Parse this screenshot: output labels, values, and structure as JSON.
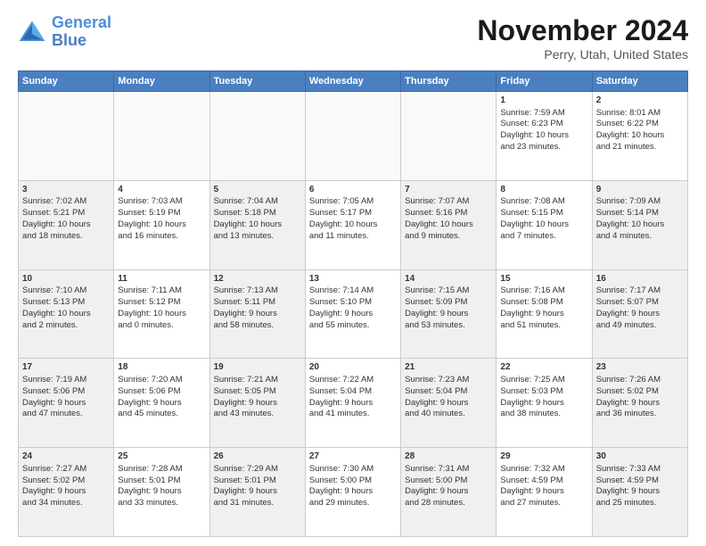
{
  "header": {
    "logo_line1": "General",
    "logo_line2": "Blue",
    "title": "November 2024",
    "location": "Perry, Utah, United States"
  },
  "weekdays": [
    "Sunday",
    "Monday",
    "Tuesday",
    "Wednesday",
    "Thursday",
    "Friday",
    "Saturday"
  ],
  "weeks": [
    [
      {
        "day": "",
        "content": "",
        "empty": true
      },
      {
        "day": "",
        "content": "",
        "empty": true
      },
      {
        "day": "",
        "content": "",
        "empty": true
      },
      {
        "day": "",
        "content": "",
        "empty": true
      },
      {
        "day": "",
        "content": "",
        "empty": true
      },
      {
        "day": "1",
        "content": "Sunrise: 7:59 AM\nSunset: 6:23 PM\nDaylight: 10 hours\nand 23 minutes."
      },
      {
        "day": "2",
        "content": "Sunrise: 8:01 AM\nSunset: 6:22 PM\nDaylight: 10 hours\nand 21 minutes."
      }
    ],
    [
      {
        "day": "3",
        "content": "Sunrise: 7:02 AM\nSunset: 5:21 PM\nDaylight: 10 hours\nand 18 minutes.",
        "shaded": true
      },
      {
        "day": "4",
        "content": "Sunrise: 7:03 AM\nSunset: 5:19 PM\nDaylight: 10 hours\nand 16 minutes."
      },
      {
        "day": "5",
        "content": "Sunrise: 7:04 AM\nSunset: 5:18 PM\nDaylight: 10 hours\nand 13 minutes.",
        "shaded": true
      },
      {
        "day": "6",
        "content": "Sunrise: 7:05 AM\nSunset: 5:17 PM\nDaylight: 10 hours\nand 11 minutes."
      },
      {
        "day": "7",
        "content": "Sunrise: 7:07 AM\nSunset: 5:16 PM\nDaylight: 10 hours\nand 9 minutes.",
        "shaded": true
      },
      {
        "day": "8",
        "content": "Sunrise: 7:08 AM\nSunset: 5:15 PM\nDaylight: 10 hours\nand 7 minutes."
      },
      {
        "day": "9",
        "content": "Sunrise: 7:09 AM\nSunset: 5:14 PM\nDaylight: 10 hours\nand 4 minutes.",
        "shaded": true
      }
    ],
    [
      {
        "day": "10",
        "content": "Sunrise: 7:10 AM\nSunset: 5:13 PM\nDaylight: 10 hours\nand 2 minutes.",
        "shaded": true
      },
      {
        "day": "11",
        "content": "Sunrise: 7:11 AM\nSunset: 5:12 PM\nDaylight: 10 hours\nand 0 minutes."
      },
      {
        "day": "12",
        "content": "Sunrise: 7:13 AM\nSunset: 5:11 PM\nDaylight: 9 hours\nand 58 minutes.",
        "shaded": true
      },
      {
        "day": "13",
        "content": "Sunrise: 7:14 AM\nSunset: 5:10 PM\nDaylight: 9 hours\nand 55 minutes."
      },
      {
        "day": "14",
        "content": "Sunrise: 7:15 AM\nSunset: 5:09 PM\nDaylight: 9 hours\nand 53 minutes.",
        "shaded": true
      },
      {
        "day": "15",
        "content": "Sunrise: 7:16 AM\nSunset: 5:08 PM\nDaylight: 9 hours\nand 51 minutes."
      },
      {
        "day": "16",
        "content": "Sunrise: 7:17 AM\nSunset: 5:07 PM\nDaylight: 9 hours\nand 49 minutes.",
        "shaded": true
      }
    ],
    [
      {
        "day": "17",
        "content": "Sunrise: 7:19 AM\nSunset: 5:06 PM\nDaylight: 9 hours\nand 47 minutes.",
        "shaded": true
      },
      {
        "day": "18",
        "content": "Sunrise: 7:20 AM\nSunset: 5:06 PM\nDaylight: 9 hours\nand 45 minutes."
      },
      {
        "day": "19",
        "content": "Sunrise: 7:21 AM\nSunset: 5:05 PM\nDaylight: 9 hours\nand 43 minutes.",
        "shaded": true
      },
      {
        "day": "20",
        "content": "Sunrise: 7:22 AM\nSunset: 5:04 PM\nDaylight: 9 hours\nand 41 minutes."
      },
      {
        "day": "21",
        "content": "Sunrise: 7:23 AM\nSunset: 5:04 PM\nDaylight: 9 hours\nand 40 minutes.",
        "shaded": true
      },
      {
        "day": "22",
        "content": "Sunrise: 7:25 AM\nSunset: 5:03 PM\nDaylight: 9 hours\nand 38 minutes."
      },
      {
        "day": "23",
        "content": "Sunrise: 7:26 AM\nSunset: 5:02 PM\nDaylight: 9 hours\nand 36 minutes.",
        "shaded": true
      }
    ],
    [
      {
        "day": "24",
        "content": "Sunrise: 7:27 AM\nSunset: 5:02 PM\nDaylight: 9 hours\nand 34 minutes.",
        "shaded": true
      },
      {
        "day": "25",
        "content": "Sunrise: 7:28 AM\nSunset: 5:01 PM\nDaylight: 9 hours\nand 33 minutes."
      },
      {
        "day": "26",
        "content": "Sunrise: 7:29 AM\nSunset: 5:01 PM\nDaylight: 9 hours\nand 31 minutes.",
        "shaded": true
      },
      {
        "day": "27",
        "content": "Sunrise: 7:30 AM\nSunset: 5:00 PM\nDaylight: 9 hours\nand 29 minutes."
      },
      {
        "day": "28",
        "content": "Sunrise: 7:31 AM\nSunset: 5:00 PM\nDaylight: 9 hours\nand 28 minutes.",
        "shaded": true
      },
      {
        "day": "29",
        "content": "Sunrise: 7:32 AM\nSunset: 4:59 PM\nDaylight: 9 hours\nand 27 minutes."
      },
      {
        "day": "30",
        "content": "Sunrise: 7:33 AM\nSunset: 4:59 PM\nDaylight: 9 hours\nand 25 minutes.",
        "shaded": true
      }
    ]
  ]
}
